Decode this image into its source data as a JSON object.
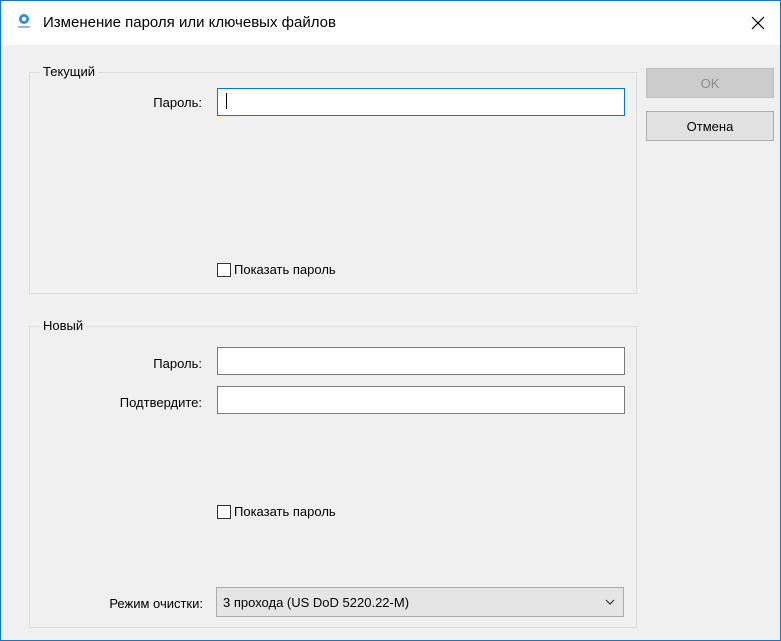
{
  "window": {
    "title": "Изменение пароля или ключевых файлов",
    "icon": "app-logo-icon",
    "close_icon": "close-icon"
  },
  "current": {
    "legend": "Текущий",
    "password_label": "Пароль:",
    "password_value": "",
    "show_password_label": "Показать пароль"
  },
  "new": {
    "legend": "Новый",
    "password_label": "Пароль:",
    "password_value": "",
    "confirm_label": "Подтвердите:",
    "confirm_value": "",
    "show_password_label": "Показать пароль",
    "wipe_mode_label": "Режим очистки:",
    "wipe_mode_value": "3 прохода (US DoD 5220.22-M)"
  },
  "buttons": {
    "ok_label": "OK",
    "cancel_label": "Отмена"
  },
  "colors": {
    "accent": "#0078d7",
    "window_border": "#1a73c7",
    "dialog_bg": "#f0f0f0",
    "disabled_button": "#cccccc"
  }
}
